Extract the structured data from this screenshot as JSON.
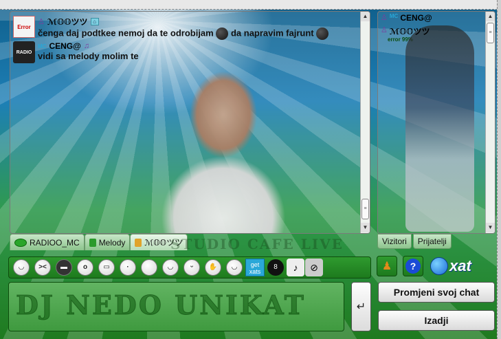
{
  "messages": [
    {
      "user": "ℳ𝕆𝕆ツツ",
      "avatar_label": "Error",
      "text": "čenga daj podtkee nemoj da te odrobijam",
      "text_after_emoji": "da napravim fajrunt"
    },
    {
      "user": "CENG@",
      "user_prefix": "MC",
      "avatar_label": "RADIO",
      "text": "vidi sa melody  molim te"
    }
  ],
  "main_tabs": [
    {
      "label": "RADIOO_MC",
      "icon": "speech-bubble-icon"
    },
    {
      "label": "Melody",
      "icon": "lock-icon"
    },
    {
      "label": "ℳ𝕆𝕆ツツ",
      "icon": "lock-open-icon"
    }
  ],
  "watermark_text": "STUDIO CAFE LIVE",
  "users": [
    {
      "name": "CENG@",
      "prefix": "MC",
      "status": ""
    },
    {
      "name": "ℳ𝕆𝕆ツツ",
      "prefix": "",
      "status": "error 99%"
    }
  ],
  "user_tabs": [
    "Vizitori",
    "Prijatelji"
  ],
  "toolbar": {
    "get_xats": "get xats",
    "smileys": [
      "smile",
      "wink",
      "dark",
      "shocked",
      "grin",
      "whistle",
      "blank",
      "smirk",
      "crazy",
      "wave",
      "laugh"
    ]
  },
  "brand": "xat",
  "input_watermark": "DJ NEDO UNIKAT",
  "buttons": {
    "send": "↵",
    "change_chat": "Promjeni svoj chat",
    "exit": "Izadji"
  },
  "colors": {
    "accent_green": "#2f9a2f",
    "help_blue": "#1a4bd6",
    "xats_blue": "#2aa8d8"
  }
}
